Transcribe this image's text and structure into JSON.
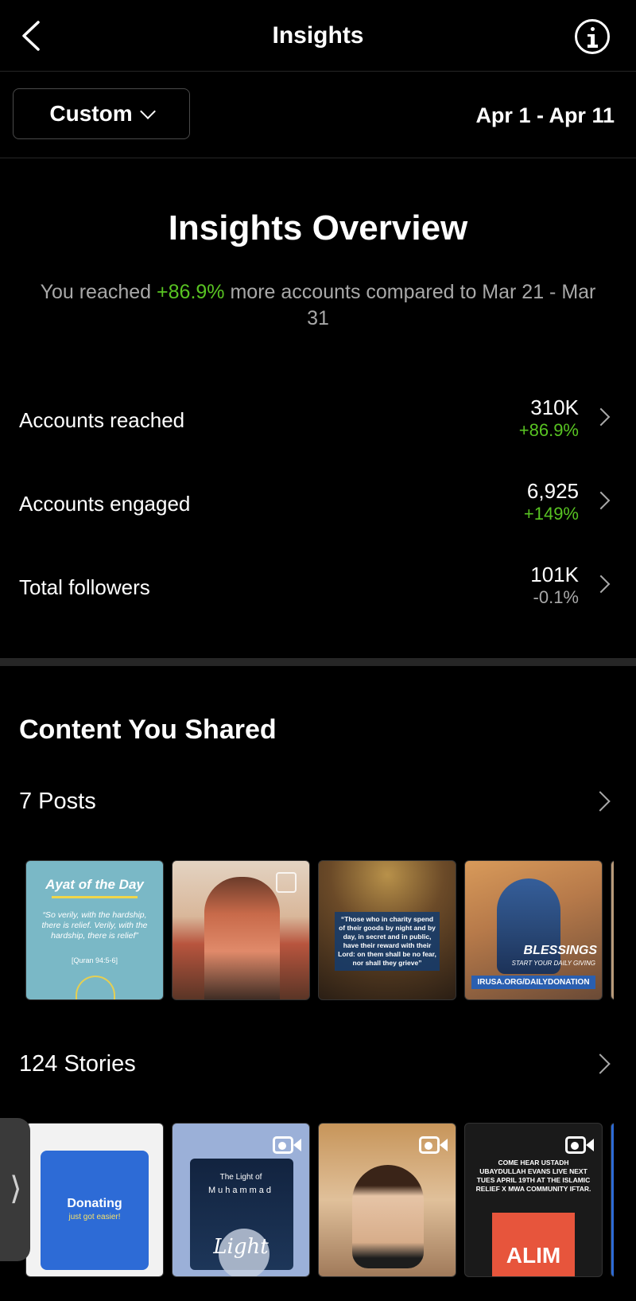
{
  "header": {
    "title": "Insights"
  },
  "filter": {
    "preset_label": "Custom",
    "date_range": "Apr 1 - Apr 11"
  },
  "overview": {
    "title": "Insights Overview",
    "desc_prefix": "You reached ",
    "desc_highlight": "+86.9%",
    "desc_suffix": " more accounts compared to Mar 21 - Mar 31"
  },
  "metrics": [
    {
      "label": "Accounts reached",
      "value": "310K",
      "change": "+86.9%",
      "trend": "up"
    },
    {
      "label": "Accounts engaged",
      "value": "6,925",
      "change": "+149%",
      "trend": "up"
    },
    {
      "label": "Total followers",
      "value": "101K",
      "change": "-0.1%",
      "trend": "down"
    }
  ],
  "content": {
    "title": "Content You Shared",
    "posts_label": "7 Posts",
    "stories_label": "124 Stories",
    "posts": [
      {
        "title": "Ayat of the Day",
        "quote": "“So verily, with the hardship, there is relief. Verily, with the hardship, there is relief”",
        "ref": "[Quran 94:5-6]"
      },
      {
        "title": ""
      },
      {
        "quote": "“Those who in charity spend of their goods by night and by day, in secret and in public, have their reward with their Lord: on them shall be no fear, nor shall they grieve”"
      },
      {
        "big": "BLESSINGS",
        "small": "START YOUR DAILY GIVING",
        "url": "IRUSA.ORG/DAILYDONATION"
      }
    ],
    "stories": [
      {
        "big": "Donating",
        "small": "just got easier!"
      },
      {
        "top": "The Light of",
        "name": "Muhammad",
        "script": "Light"
      },
      {
        "text": ""
      },
      {
        "caps": "COME HEAR USTADH UBAYDULLAH EVANS LIVE NEXT TUES APRIL 19TH AT THE ISLAMIC RELIEF X MWA COMMUNITY IFTAR.",
        "big": "ALIM"
      }
    ]
  },
  "colors": {
    "background": "#000000",
    "positive": "#58c322",
    "muted": "#a8a8a8",
    "divider": "#262626"
  }
}
